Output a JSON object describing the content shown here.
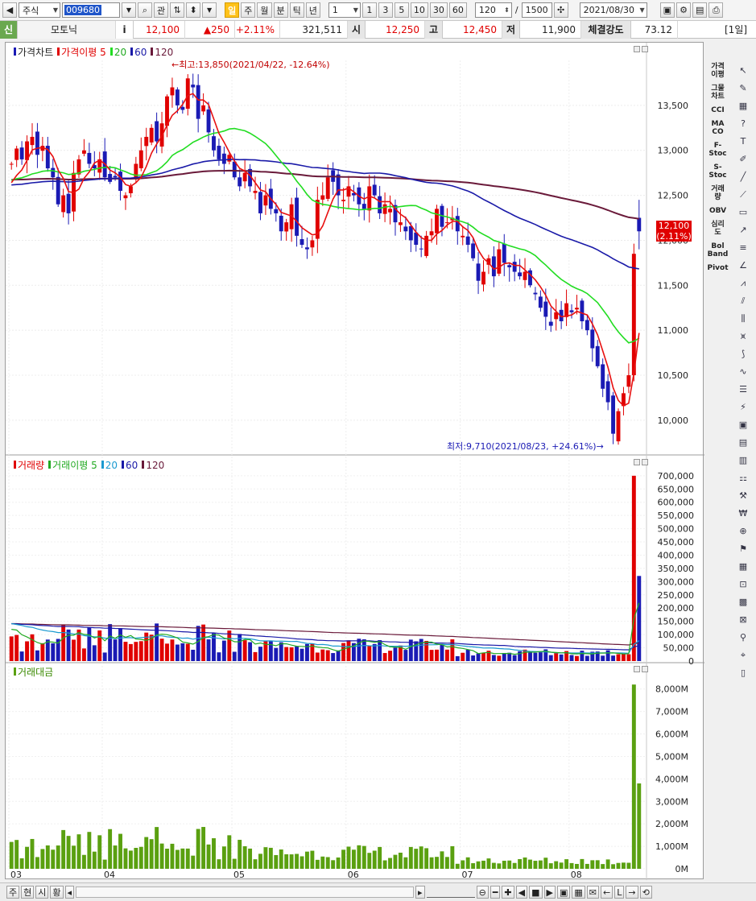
{
  "toolbar": {
    "market": "주식",
    "code": "009680",
    "kwan": "관",
    "periods": [
      "일",
      "주",
      "월",
      "분",
      "틱",
      "년"
    ],
    "interval_value": "1",
    "intervals": [
      "1",
      "3",
      "5",
      "10",
      "30",
      "60"
    ],
    "count_value": "120",
    "slash": "/",
    "total_value": "1500",
    "date_value": "2021/08/30"
  },
  "quote": {
    "sin": "신",
    "name": "모토닉",
    "info": "i",
    "price": "12,100",
    "change": "▲250",
    "rate": "+2.11%",
    "volume": "321,511",
    "open_label": "시",
    "open": "12,250",
    "high_label": "고",
    "high": "12,450",
    "low_label": "저",
    "low": "11,900",
    "strength_label": "체결강도",
    "strength": "73.12",
    "period_tag": "[1일]"
  },
  "price_panel": {
    "title": "가격차트",
    "ma_title": "가격이평",
    "ma_periods": [
      "5",
      "20",
      "60",
      "120"
    ],
    "high_annotation": "←최고:13,850(2021/04/22, -12.64%)",
    "low_annotation": "최저:9,710(2021/08/23, +24.61%)→",
    "current_price": "12,100",
    "current_rate": "(2.11%)"
  },
  "volume_panel": {
    "title": "거래량",
    "ma_title": "거래이평",
    "ma_periods": [
      "5",
      "20",
      "60",
      "120"
    ]
  },
  "amount_panel": {
    "title": "거래대금"
  },
  "side_indicators": [
    "가격\n이평",
    "그물\n차트",
    "CCI",
    "MA\nCO",
    "F-\nStoc",
    "S-\nStoc",
    "거래\n량",
    "OBV",
    "심리\n도",
    "Bol\nBand",
    "Pivot"
  ],
  "bottom": {
    "buttons": [
      "주",
      "현",
      "시",
      "황"
    ]
  },
  "colors": {
    "up": "#e00000",
    "down": "#1a1ab4",
    "ma5": "#e81010",
    "ma20": "#22dd22",
    "ma60": "#1a1aa8",
    "ma120": "#6a1a3a",
    "amount": "#5aa010"
  },
  "chart_data": [
    {
      "type": "candlestick",
      "title": "가격차트",
      "x_labels": [
        "03",
        "04",
        "05",
        "06",
        "07",
        "08"
      ],
      "y_ticks": [
        10000,
        10500,
        11000,
        11500,
        12000,
        12500,
        13000,
        13500
      ],
      "y_tick_labels": [
        "10,000",
        "10,500",
        "11,000",
        "11,500",
        "12,000",
        "12,500",
        "13,000",
        "13,500"
      ],
      "ylim": [
        9650,
        14000
      ],
      "close_series": [
        12850,
        13020,
        12900,
        13100,
        13150,
        12950,
        13050,
        12800,
        12700,
        12400,
        12500,
        12300,
        12750,
        12900,
        13000,
        12850,
        12800,
        12900,
        12700,
        12650,
        12700,
        12550,
        12500,
        12600,
        12850,
        13000,
        13150,
        13250,
        13100,
        13300,
        13600,
        13700,
        13500,
        13450,
        13800,
        13700,
        13350,
        13500,
        13200,
        13000,
        12900,
        12850,
        12950,
        12700,
        12600,
        12750,
        12600,
        12550,
        12300,
        12500,
        12350,
        12300,
        12100,
        12200,
        12400,
        12050,
        11950,
        11900,
        12000,
        12450,
        12500,
        12700,
        12650,
        12500,
        12450,
        12600,
        12500,
        12400,
        12350,
        12600,
        12500,
        12300,
        12400,
        12350,
        12200,
        12200,
        12100,
        12000,
        11950,
        11900,
        12050,
        12100,
        12350,
        12150,
        12200,
        12250,
        12100,
        12050,
        11950,
        11800,
        11550,
        11650,
        11800,
        11600,
        11900,
        11750,
        11700,
        11650,
        11600,
        11650,
        11500,
        11400,
        11250,
        11150,
        11050,
        11200,
        11100,
        11300,
        11200,
        11250,
        11100,
        11000,
        10800,
        10600,
        10350,
        10200,
        9850,
        10100,
        10300,
        10500,
        11850,
        12100
      ],
      "high_annotation": "←최고:13,850(2021/04/22, -12.64%)",
      "low_annotation": "최저:9,710(2021/08/23, +24.61%)→"
    },
    {
      "type": "bar",
      "title": "거래량",
      "y_ticks": [
        0,
        50000,
        100000,
        150000,
        200000,
        250000,
        300000,
        350000,
        400000,
        450000,
        500000,
        550000,
        600000,
        650000,
        700000
      ],
      "y_tick_labels": [
        "0",
        "50,000",
        "100,000",
        "150,000",
        "200,000",
        "250,000",
        "300,000",
        "350,000",
        "400,000",
        "450,000",
        "500,000",
        "550,000",
        "600,000",
        "650,000",
        "700,000"
      ],
      "ylim": [
        0,
        730000
      ],
      "last_values": [
        700000,
        321511
      ]
    },
    {
      "type": "bar",
      "title": "거래대금",
      "y_ticks": [
        0,
        1000,
        2000,
        3000,
        4000,
        5000,
        6000,
        7000,
        8000
      ],
      "y_tick_labels": [
        "0M",
        "1,000M",
        "2,000M",
        "3,000M",
        "4,000M",
        "5,000M",
        "6,000M",
        "7,000M",
        "8,000M"
      ],
      "ylim": [
        0,
        8600
      ],
      "last_values": [
        8200,
        3800
      ]
    }
  ]
}
